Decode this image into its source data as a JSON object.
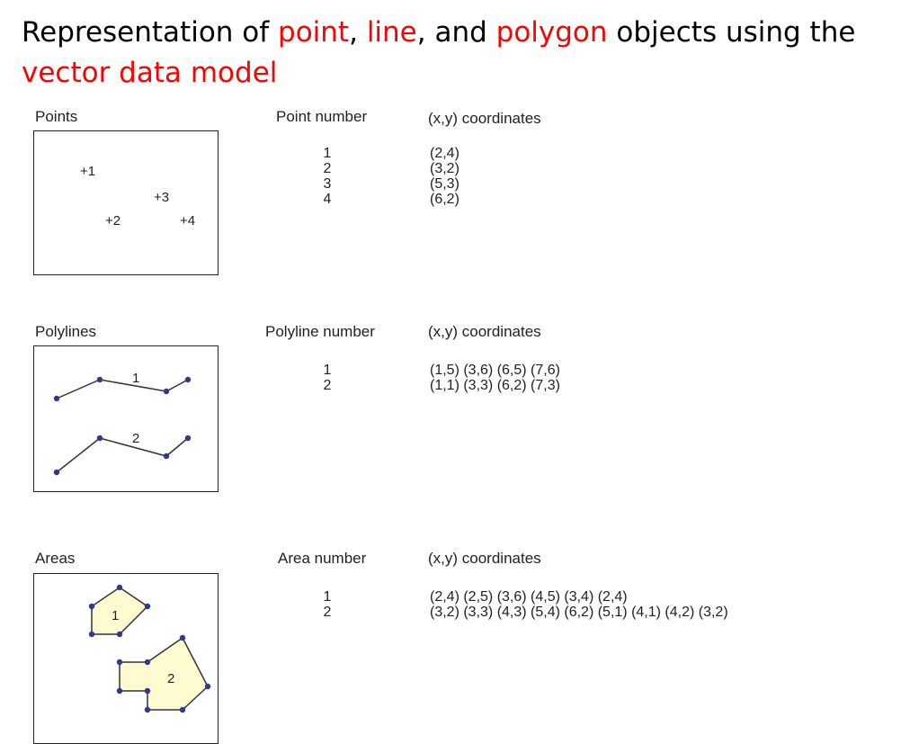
{
  "title": {
    "p1": "Representation of ",
    "h1": "point",
    "p2": ", ",
    "h2": "line",
    "p3": ", and ",
    "h3": "polygon",
    "p4": " objects using the ",
    "h4": "vector data model"
  },
  "colors": {
    "highlight": "#ff0000",
    "vertex": "#2e3a8c",
    "area_fill": "#fffbd0"
  },
  "points": {
    "section_label": "Points",
    "number_header": "Point number",
    "coord_header": "(x,y) coordinates",
    "items": [
      {
        "id": "1",
        "coords": "(2,4)",
        "marker": "+1"
      },
      {
        "id": "2",
        "coords": "(3,2)",
        "marker": "+2"
      },
      {
        "id": "3",
        "coords": "(5,3)",
        "marker": "+3"
      },
      {
        "id": "4",
        "coords": "(6,2)",
        "marker": "+4"
      }
    ]
  },
  "polylines": {
    "section_label": "Polylines",
    "number_header": "Polyline number",
    "coord_header": "(x,y) coordinates",
    "items": [
      {
        "id": "1",
        "coords": "(1,5) (3,6) (6,5) (7,6)"
      },
      {
        "id": "2",
        "coords": "(1,1) (3,3) (6,2) (7,3)"
      }
    ]
  },
  "areas": {
    "section_label": "Areas",
    "number_header": "Area number",
    "coord_header": "(x,y) coordinates",
    "items": [
      {
        "id": "1",
        "coords": "(2,4) (2,5) (3,6) (4,5) (3,4) (2,4)"
      },
      {
        "id": "2",
        "coords": "(3,2) (3,3) (4,3) (5,4) (6,2) (5,1) (4,1) (4,2) (3,2)"
      }
    ]
  }
}
